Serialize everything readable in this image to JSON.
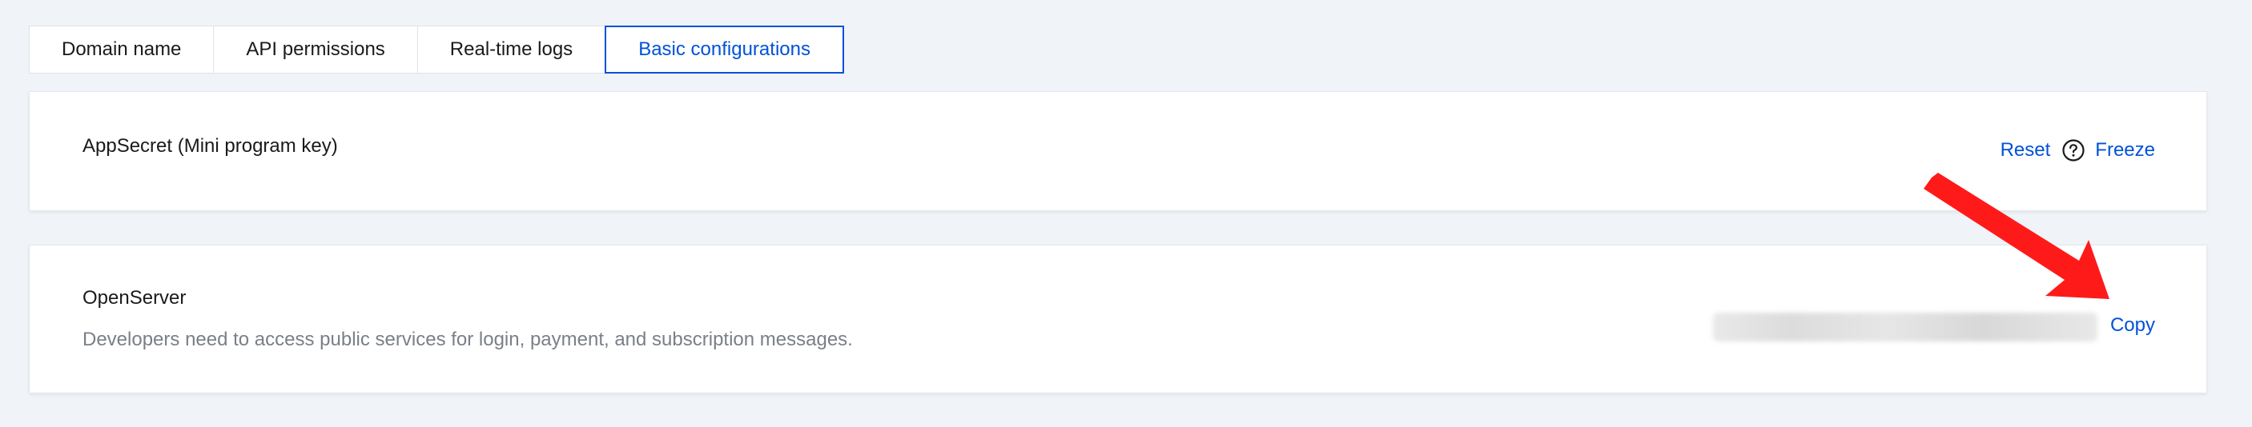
{
  "tabs": [
    {
      "label": "Domain name",
      "active": false
    },
    {
      "label": "API permissions",
      "active": false
    },
    {
      "label": "Real-time logs",
      "active": false
    },
    {
      "label": "Basic configurations",
      "active": true
    }
  ],
  "appsecret": {
    "title": "AppSecret (Mini program key)",
    "reset_label": "Reset",
    "help_icon": "question-circle-icon",
    "freeze_label": "Freeze"
  },
  "openserver": {
    "title": "OpenServer",
    "description": "Developers need to access public services for login, payment, and subscription messages.",
    "copy_label": "Copy"
  },
  "colors": {
    "accent": "#0052d9",
    "annotation_arrow": "#ff1a1a",
    "background": "#f0f3f8"
  }
}
